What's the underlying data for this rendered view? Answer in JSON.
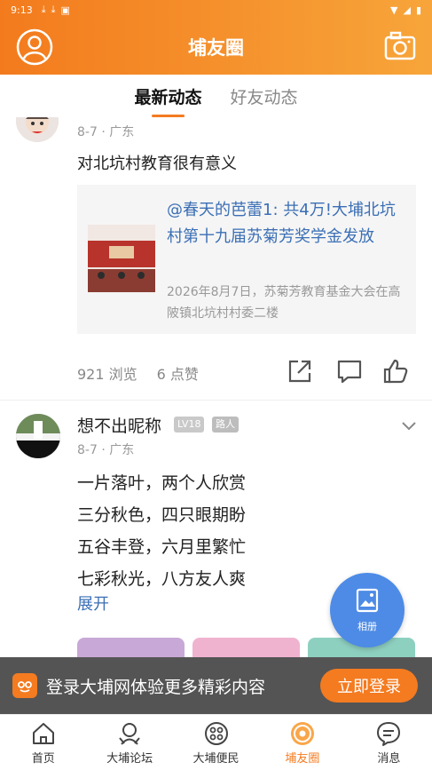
{
  "status_bar": {
    "time": "9:13"
  },
  "header": {
    "title": "埔友圈"
  },
  "tabs": [
    {
      "label": "最新动态",
      "active": true
    },
    {
      "label": "好友动态",
      "active": false
    }
  ],
  "post1": {
    "meta": "8-7 · 广东",
    "text": "对北坑村教育很有意义",
    "share": {
      "title": "@春天的芭蕾1: 共4万!大埔北坑村第十九届苏菊芳奖学金发放",
      "subtitle": "2026年8月7日，苏菊芳教育基金大会在高陂镇北坑村村委二楼"
    },
    "views": "921 浏览",
    "likes": "6 点赞"
  },
  "post2": {
    "username": "想不出昵称",
    "level": "LV18",
    "role": "路人",
    "meta": "8-7 · 广东",
    "lines": [
      "一片落叶，两个人欣赏",
      "三分秋色，四只眼期盼",
      "五谷丰登，六月里繁忙",
      "七彩秋光，八方友人爽"
    ],
    "expand": "展开"
  },
  "fab": {
    "label": "相册"
  },
  "login_banner": {
    "text": "登录大埔网体验更多精彩内容",
    "button": "立即登录"
  },
  "nav": [
    {
      "label": "首页",
      "icon": "home-icon",
      "active": false
    },
    {
      "label": "大埔论坛",
      "icon": "forum-icon",
      "active": false
    },
    {
      "label": "大埔便民",
      "icon": "services-icon",
      "active": false
    },
    {
      "label": "埔友圈",
      "icon": "circle-icon",
      "active": true
    },
    {
      "label": "消息",
      "icon": "message-icon",
      "active": false
    }
  ],
  "colors": {
    "accent": "#f47b20",
    "link": "#3b6fb5",
    "fab": "#4d8be6"
  }
}
